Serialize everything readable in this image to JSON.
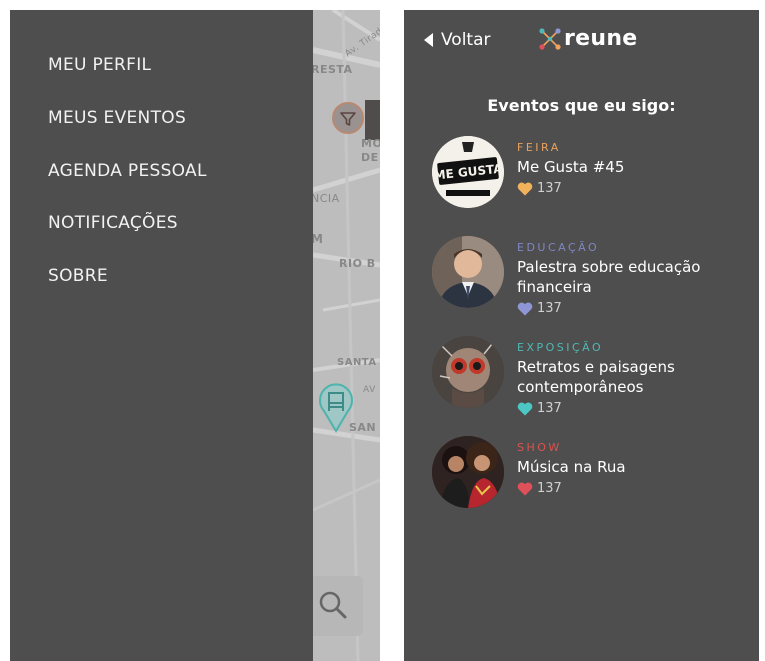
{
  "left_screen": {
    "menu": [
      {
        "label": "MEU PERFIL"
      },
      {
        "label": "MEUS EVENTOS"
      },
      {
        "label": "AGENDA PESSOAL"
      },
      {
        "label": "NOTIFICAÇÕES"
      },
      {
        "label": "SOBRE"
      }
    ],
    "map": {
      "labels": [
        "RESTA",
        "Av. Tiradentes",
        "MO",
        "DE",
        "NCIA",
        "M",
        "RIO B",
        "SANTA",
        "SAN",
        "AV"
      ]
    }
  },
  "right_screen": {
    "back_label": "Voltar",
    "logo_text": "reune",
    "section_title": "Eventos que eu sigo:",
    "events": [
      {
        "category": "FEIRA",
        "category_color": "#e8a25a",
        "title_lines": [
          "Me Gusta #45"
        ],
        "likes": "137",
        "heart_color": "#f0b35c",
        "avatar_text": "ME GUSTA"
      },
      {
        "category": "EDUCAÇÃO",
        "category_color": "#7f86c4",
        "title_lines": [
          "Palestra sobre educação",
          "financeira"
        ],
        "likes": "137",
        "heart_color": "#8f96d6"
      },
      {
        "category": "EXPOSIÇÃO",
        "category_color": "#4fb8b4",
        "title_lines": [
          "Retratos e paisagens",
          "contemporâneos"
        ],
        "likes": "137",
        "heart_color": "#4cc7c4"
      },
      {
        "category": "SHOW",
        "category_color": "#d9534f",
        "title_lines": [
          "Música na Rua"
        ],
        "likes": "137",
        "heart_color": "#e0505a"
      }
    ]
  }
}
